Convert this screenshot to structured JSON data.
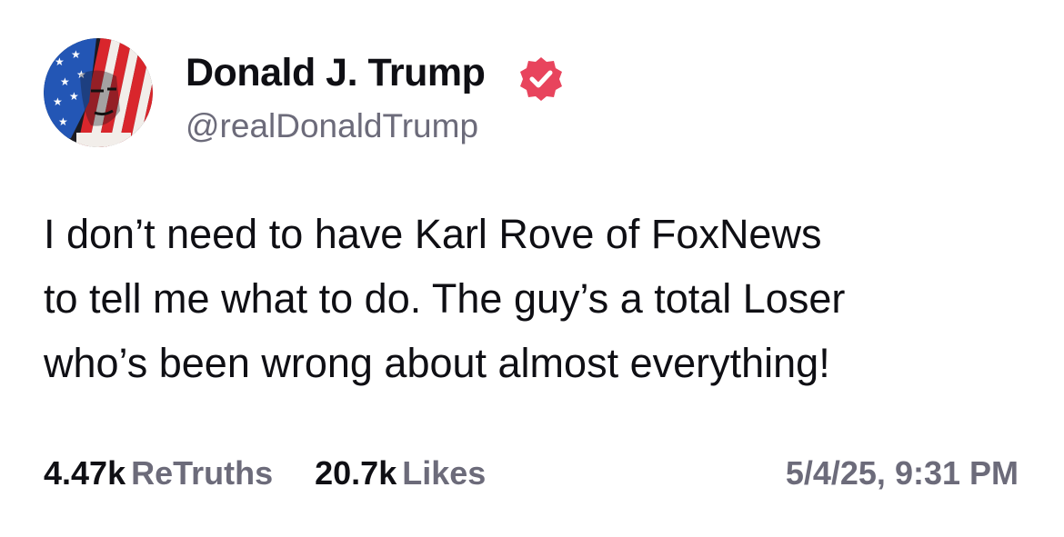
{
  "post": {
    "author": {
      "display_name": "Donald J. Trump",
      "handle": "@realDonaldTrump",
      "verified": true,
      "verified_icon": "verified-badge-icon",
      "avatar_icon": "flag-portrait-avatar"
    },
    "body_lines": [
      "I don’t need to have Karl Rove of FoxNews",
      "to tell me what to do. The guy’s a total Loser",
      "who’s been wrong about almost everything!"
    ],
    "stats": {
      "retruths_count": "4.47k",
      "retruths_label": "ReTruths",
      "likes_count": "20.7k",
      "likes_label": "Likes"
    },
    "timestamp": "5/4/25, 9:31 PM"
  },
  "colors": {
    "text_primary": "#0f0f14",
    "text_secondary": "#6c6b7a",
    "verified_badge": "#e8445d",
    "background": "#ffffff"
  }
}
